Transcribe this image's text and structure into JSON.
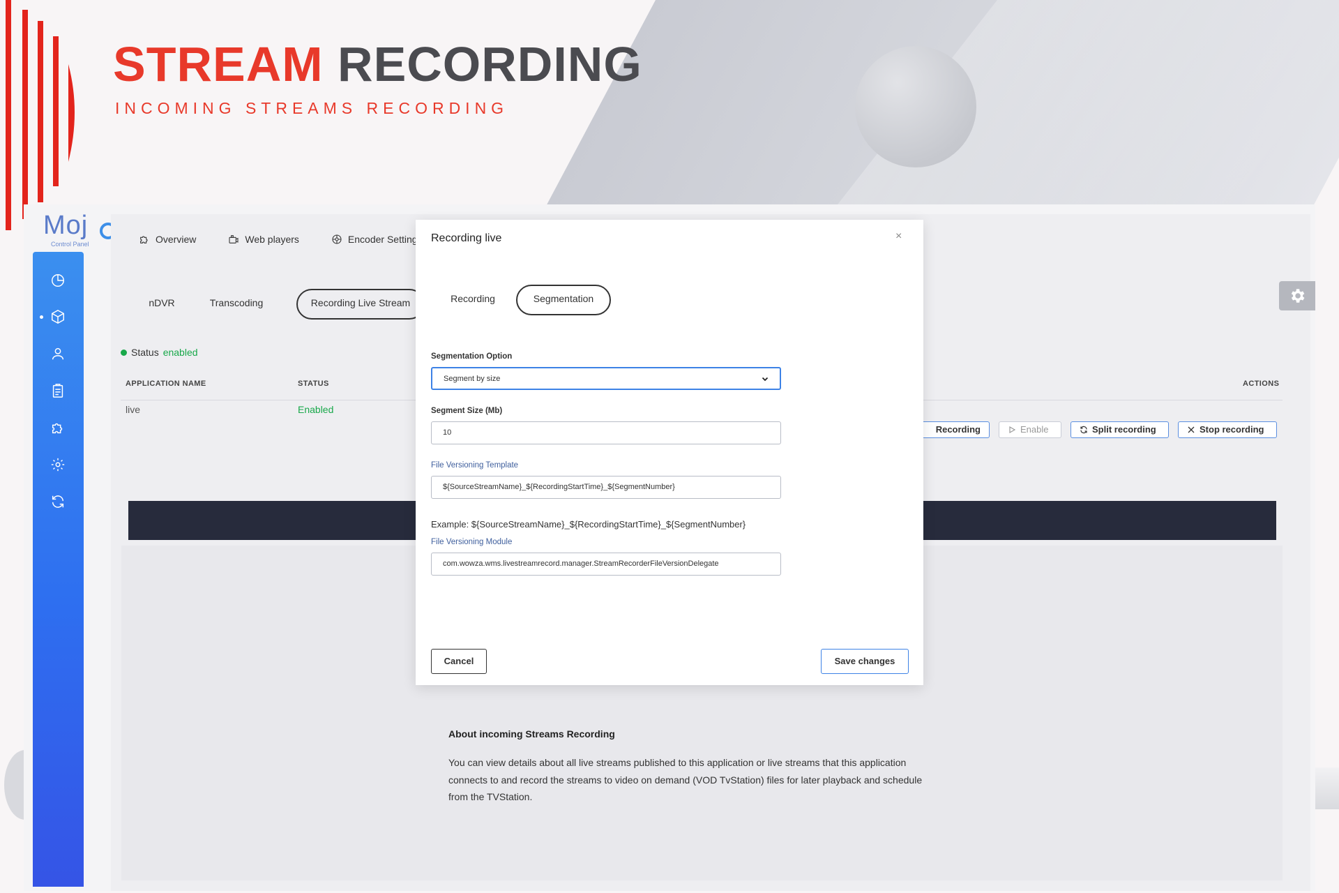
{
  "banner": {
    "title_red": "STREAM",
    "title_gray": "RECORDING",
    "subtitle": "INCOMING STREAMS RECORDING",
    "accent_color": "#e8392a"
  },
  "logo": {
    "text": "Moj",
    "sub": "Control Panel"
  },
  "sidebar": {
    "icons": [
      "dashboard-icon",
      "cube-icon",
      "user-icon",
      "clipboard-icon",
      "puzzle-icon",
      "settings-icon",
      "refresh-icon"
    ],
    "active_index": 1
  },
  "nav": {
    "overview": "Overview",
    "web_players": "Web players",
    "encoder_settings": "Encoder Setting"
  },
  "subtabs": {
    "ndvr": "nDVR",
    "transcoding": "Transcoding",
    "recording_live_stream": "Recording Live Stream"
  },
  "status": {
    "label": "Status",
    "value": "enabled"
  },
  "table": {
    "headers": {
      "application_name": "APPLICATION NAME",
      "status": "STATUS",
      "actions": "ACTIONS"
    },
    "row": {
      "app": "live",
      "status": "Enabled"
    },
    "actions": {
      "recording": "Recording",
      "enable": "Enable",
      "split": "Split recording",
      "stop": "Stop recording"
    }
  },
  "about": {
    "title": "About incoming Streams Recording",
    "text": "You can view details about all live streams published to this application or live streams that this application connects to and record the streams to video on demand (VOD TvStation) files for later playback and schedule from the TVStation."
  },
  "modal": {
    "title": "Recording live",
    "close": "×",
    "tabs": {
      "recording": "Recording",
      "segmentation": "Segmentation"
    },
    "segmentation_option": {
      "label": "Segmentation Option",
      "value": "Segment by size"
    },
    "segment_size": {
      "label": "Segment Size (Mb)",
      "value": "10"
    },
    "file_versioning_template": {
      "label": "File Versioning Template",
      "value": "${SourceStreamName}_${RecordingStartTime}_${SegmentNumber}"
    },
    "example": "Example: ${SourceStreamName}_${RecordingStartTime}_${SegmentNumber}",
    "file_versioning_module": {
      "label": "File Versioning Module",
      "value": "com.wowza.wms.livestreamrecord.manager.StreamRecorderFileVersionDelegate"
    },
    "cancel": "Cancel",
    "save": "Save changes"
  }
}
